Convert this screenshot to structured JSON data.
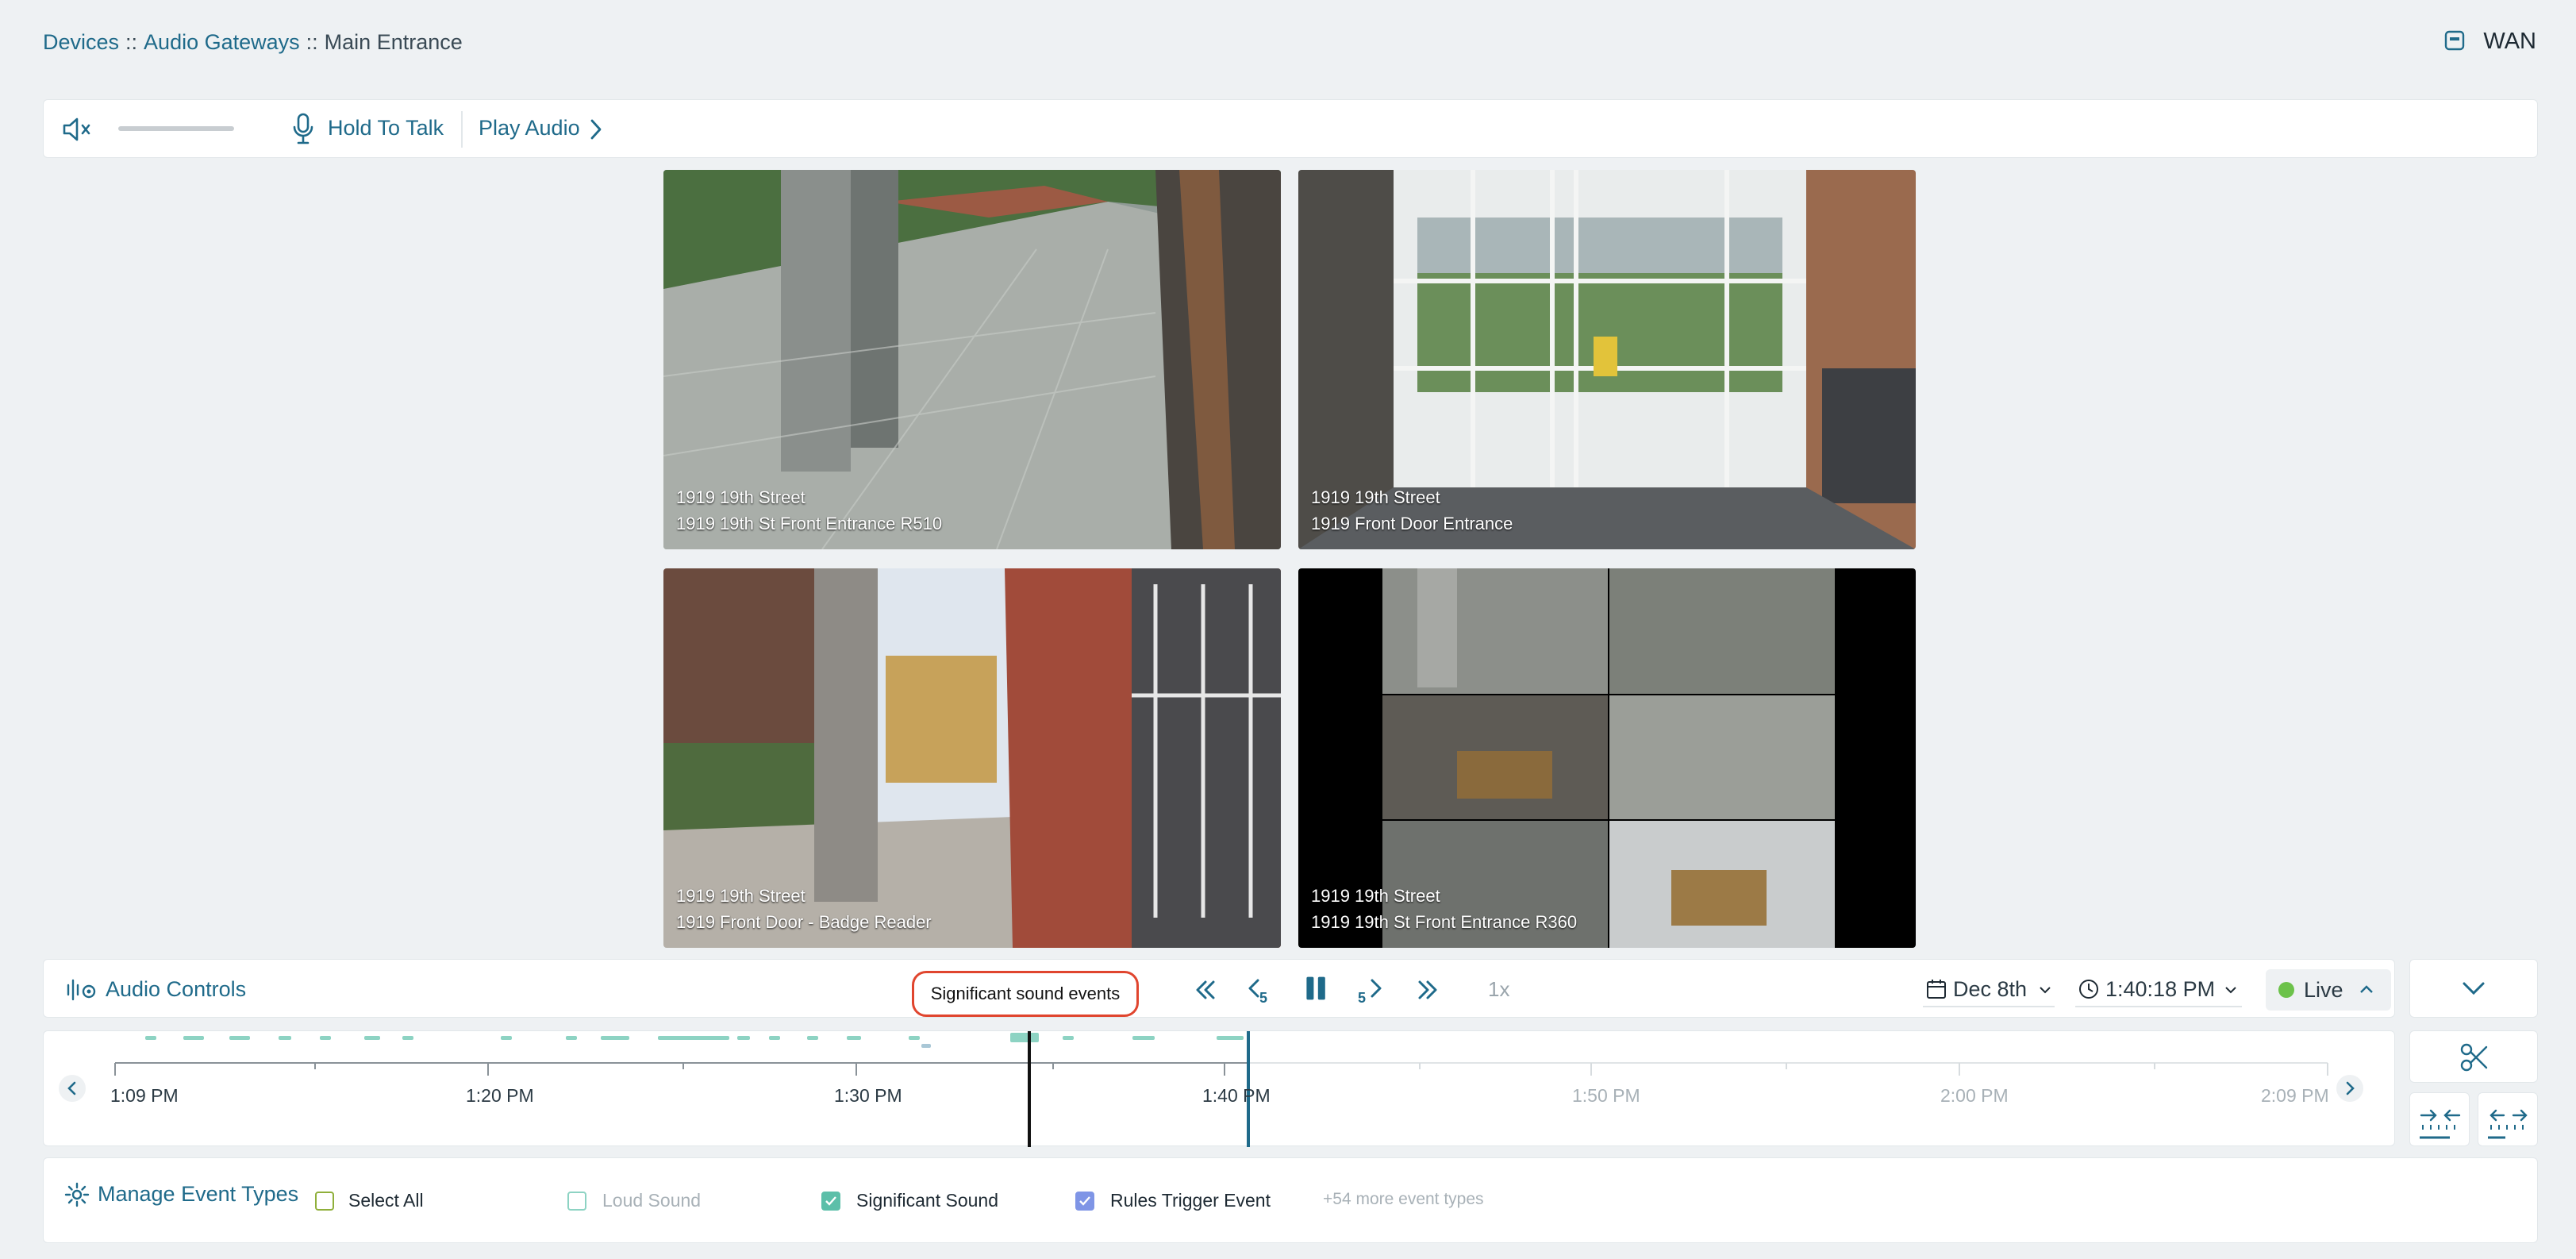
{
  "breadcrumb": {
    "devices": "Devices",
    "sep1": "::",
    "gateways": "Audio Gateways",
    "sep2": "::",
    "current": "Main Entrance"
  },
  "header": {
    "network": "WAN"
  },
  "audio_bar": {
    "hold_to_talk": "Hold To Talk",
    "play_audio": "Play Audio"
  },
  "cameras": [
    {
      "site": "1919 19th Street",
      "name": "1919 19th St Front Entrance R510"
    },
    {
      "site": "1919 19th Street",
      "name": "1919 Front Door Entrance"
    },
    {
      "site": "1919 19th Street",
      "name": "1919 Front Door - Badge Reader"
    },
    {
      "site": "1919 19th Street",
      "name": "1919 19th St Front Entrance R360"
    }
  ],
  "controls": {
    "audio_controls": "Audio Controls",
    "tooltip": "Significant sound events",
    "skip_back_seconds": "5",
    "skip_fwd_seconds": "5",
    "speed": "1x",
    "date": "Dec 8th",
    "time": "1:40:18 PM",
    "live": "Live"
  },
  "timeline": {
    "labels": [
      "1:09 PM",
      "1:20 PM",
      "1:30 PM",
      "1:40 PM",
      "1:50 PM",
      "2:00 PM",
      "2:09 PM"
    ]
  },
  "events": {
    "manage": "Manage Event Types",
    "select_all": "Select All",
    "loud_sound": "Loud Sound",
    "significant_sound": "Significant Sound",
    "rules_trigger": "Rules Trigger Event",
    "more": "+54 more event types"
  },
  "colors": {
    "accent": "#1f6a8a",
    "event_teal": "#8dd3c3",
    "live_green": "#6cc24a",
    "callout_red": "#e0452e"
  }
}
